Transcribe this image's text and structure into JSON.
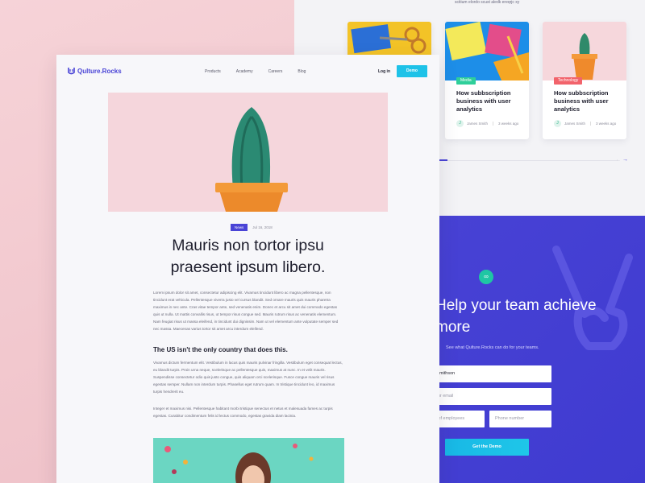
{
  "top_caption": "scitium elordo scust aledk ereqrjc xy",
  "cards": [
    {
      "badge": "Media",
      "badge_color": "#2fcf9a",
      "title": "How subbscription business with user analytics",
      "author": "James Smith",
      "time": "3 weeks ago"
    },
    {
      "badge": "Technology",
      "badge_color": "#f2636b",
      "title": "How subbscription business with user analytics",
      "author": "James Smith",
      "time": "3 weeks ago"
    }
  ],
  "slider": {
    "prev": "←",
    "next": "→"
  },
  "cta": {
    "icon": "∞",
    "title": "Help your team achieve more",
    "subtitle": "See what Qulture.Rocks can do for your teams.",
    "name_value": "s Smithson",
    "email_placeholder": "your email",
    "employees_placeholder": "er of employees",
    "phone_placeholder": "Phone number",
    "button": "Get the Demo"
  },
  "nav": {
    "logo": "Qulture.Rocks",
    "menu": [
      "Products",
      "Academy",
      "Careers",
      "Blog"
    ],
    "login": "Log in",
    "demo": "Demo"
  },
  "article": {
    "tag": "News",
    "date": "Jul 16, 2018",
    "headline": "Mauris non tortor ipsu praesent ipsum libero.",
    "p1": "Lorem ipsum dolor sit amet, consectetur adipiscing elit. Vivamus tincidunt libero ac magna pellentesque, non tincidunt erat vehicula. Pellentesque viverra justo vel cursus blandit. Sed ornare mauris quis mauris pharetra maximus in nec ante. Cras vitae tempor ante, sed venenatis enim. Donec et arcu sit amet dui commodo egestas quis ut nulla. Ut mattis convallis risus, ut tempor risus congue sed. Mauris rutrum risus ac venenatis elementum. Nam feugiat risus ut massa eleifend, in tincidunt dui dignissim. Nam ut vel elementum ante vulputate semper sed nec massa. Maecenas varius tortor sit amet arcu interdum eleifend.",
    "subhead": "The US isn't the only country that does this.",
    "p2": "Vivamus dictum fermentum elit. Vestibulum in lacus quis mauris pulvinar fringilla. Vestibulum eget consequat lectus, eu blandit turpis. Proin urna neque, scelerisque ac pellentesque quis, maximus at nunc. In et velit mauris. Suspendisse consectetur odio quis justo congue, quis aliquam orci scelerisque. Fusce congue mauris vel risus egestas semper. Nullam non interdum turpis. Phasellus eget rutrum quam. In tristique tincidunt leo, id maximus turpis hendrerit eu.",
    "p3": "Integer et maximus nisi. Pellentesque habitant morbi tristique senectus et netus et malesuada fames ac turpis egestas. Curabitur condimentum felis id lectus commodo, egestas gravida diam lacinia."
  }
}
